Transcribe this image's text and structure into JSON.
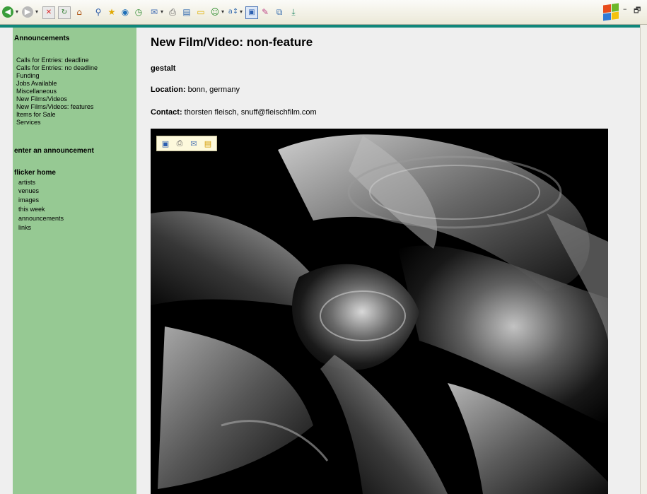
{
  "browser": {
    "toolbar_icons": [
      "back-icon",
      "forward-icon",
      "stop-icon",
      "refresh-icon",
      "home-icon",
      "search-icon",
      "favorites-icon",
      "media-icon",
      "history-icon",
      "mail-icon",
      "print-icon",
      "edit-icon",
      "discuss-icon",
      "messenger-icon",
      "research-icon",
      "windows-icon",
      "tools-icon",
      "copy-icon",
      "save-icon"
    ],
    "window_controls": {
      "minimize": "–",
      "restore": "🗗"
    }
  },
  "sidebar": {
    "section_title": "Announcements",
    "categories": [
      "Calls for Entries: deadline",
      "Calls for Entries: no deadline",
      "Funding",
      "Jobs Available",
      "Miscellaneous",
      "New Films/Videos",
      "New Films/Videos: features",
      "Items for Sale",
      "Services"
    ],
    "enter_link": "enter an announcement",
    "home_link": "flicker home",
    "home_items": [
      "artists",
      "venues",
      "images",
      "this week",
      "announcements",
      "links"
    ]
  },
  "main": {
    "title": "New Film/Video: non-feature",
    "film_title": "gestalt",
    "location_label": "Location:",
    "location_value": "bonn, germany",
    "contact_label": "Contact:",
    "contact_value": "thorsten fleisch, snuff@fleischfilm.com"
  },
  "image_toolbar": [
    "save-image-icon",
    "print-image-icon",
    "email-image-icon",
    "my-pictures-icon"
  ],
  "colors": {
    "sidebar_bg": "#96c993",
    "page_bg": "#efefef",
    "accent_line": "#10877a"
  }
}
